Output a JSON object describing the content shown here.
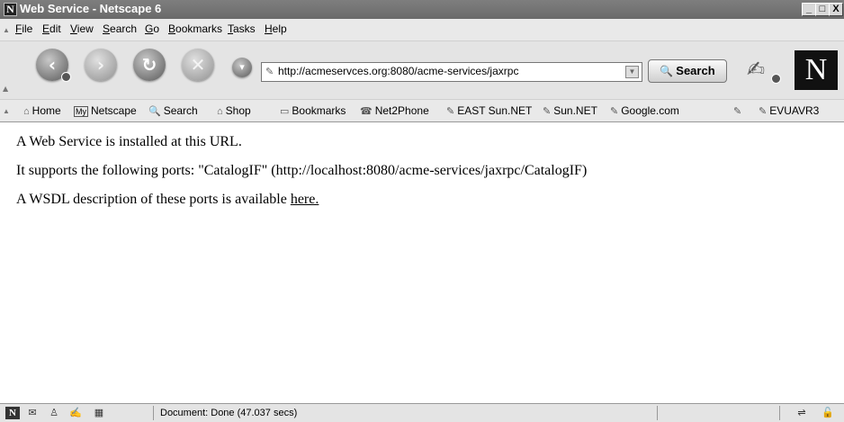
{
  "window": {
    "title": "Web Service - Netscape 6",
    "controls": [
      "_",
      "□",
      "X"
    ]
  },
  "menubar": {
    "items": [
      {
        "label": "File",
        "mnemonic": "F"
      },
      {
        "label": "Edit",
        "mnemonic": "E"
      },
      {
        "label": "View",
        "mnemonic": "V"
      },
      {
        "label": "Search",
        "mnemonic": "S"
      },
      {
        "label": "Go",
        "mnemonic": "G"
      },
      {
        "label": "Bookmarks",
        "mnemonic": "B"
      },
      {
        "label": "Tasks",
        "mnemonic": "T"
      },
      {
        "label": "Help",
        "mnemonic": "H"
      }
    ]
  },
  "navbar": {
    "url": "http://acmeservces.org:8080/acme-services/jaxrpc",
    "search_label": "Search",
    "logo_text": "N",
    "icons": [
      "back-icon",
      "forward-icon",
      "reload-icon",
      "stop-icon",
      "dropdown-icon",
      "print-icon"
    ]
  },
  "bookmarks": {
    "items": [
      {
        "label": "Home",
        "icon": "home-icon"
      },
      {
        "label": "Netscape",
        "icon": "my-netscape-icon",
        "badge": "My"
      },
      {
        "label": "Search",
        "icon": "search-icon"
      },
      {
        "label": "Shop",
        "icon": "shop-icon"
      },
      {
        "label": "Bookmarks",
        "icon": "bookmarks-folder-icon"
      },
      {
        "label": "Net2Phone",
        "icon": "net2phone-icon"
      },
      {
        "label": "EAST Sun.NET",
        "icon": "link-icon"
      },
      {
        "label": "Sun.NET",
        "icon": "link-icon"
      },
      {
        "label": "Google.com",
        "icon": "link-icon"
      },
      {
        "label": "",
        "icon": "link-icon"
      },
      {
        "label": "EVUAVR3",
        "icon": "link-icon"
      }
    ]
  },
  "content": {
    "line1": "A Web Service is installed at this URL.",
    "line2": "It supports the following ports: \"CatalogIF\" (http://localhost:8080/acme-services/jaxrpc/CatalogIF)",
    "line3_prefix": "A WSDL description of these ports is available ",
    "line3_link": "here."
  },
  "status": {
    "text": "Document: Done (47.037 secs)",
    "logo_text": "N",
    "icons": [
      "navigator-icon",
      "mail-icon",
      "instant-messenger-icon",
      "composer-icon",
      "address-book-icon",
      "online-connection-icon",
      "security-lock-icon"
    ]
  }
}
